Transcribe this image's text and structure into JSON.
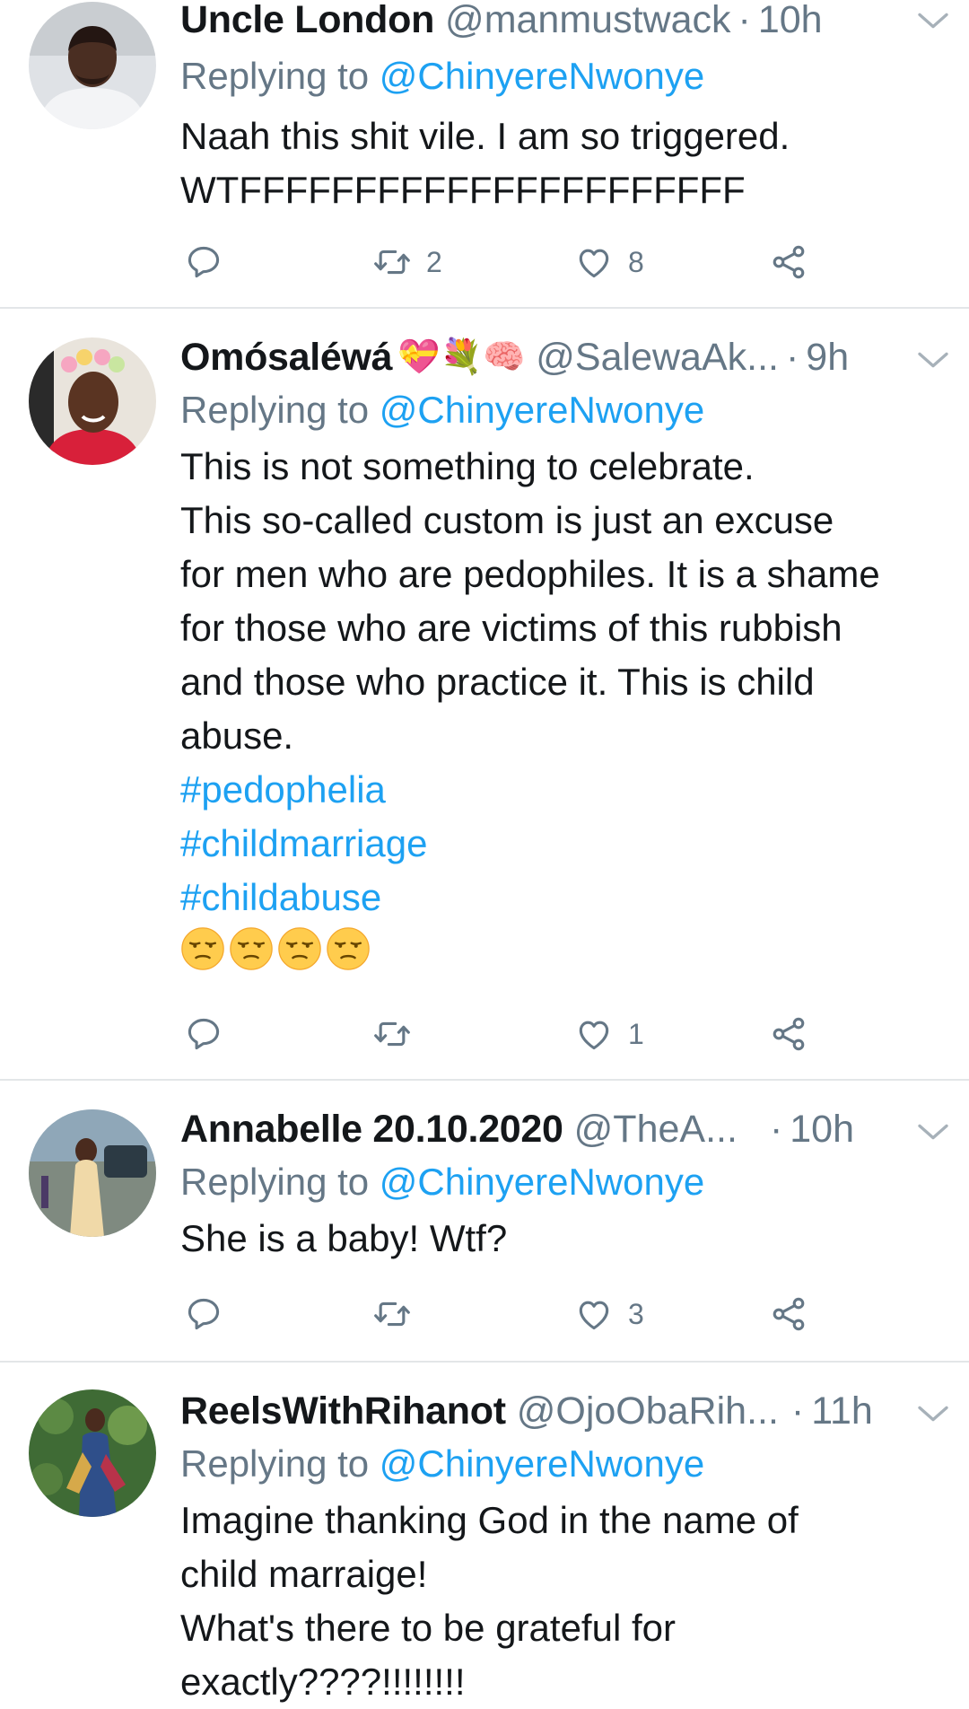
{
  "tweets": [
    {
      "name": "Uncle London",
      "handle": "@manmustwack",
      "dot": "·",
      "time": "10h",
      "reply_prefix": "Replying to ",
      "reply_to": "@ChinyereNwonye",
      "text": "Naah this shit vile. I am so triggered.\nWTFFFFFFFFFFFFFFFFFFFFFF",
      "retweets": "2",
      "likes": "8"
    },
    {
      "name": "Omósaléwá",
      "name_emojis": "💝💐🧠",
      "handle": "@SalewaAk...",
      "dot": "·",
      "time": "9h",
      "reply_prefix": "Replying to ",
      "reply_to": "@ChinyereNwonye",
      "text": "This is not something to celebrate.\nThis so-called custom is just an excuse\nfor men who are pedophiles. It is a shame\nfor those who are victims of this rubbish\nand those who practice it. This is child\nabuse.",
      "hashtags": [
        "#pedophelia",
        "#childmarriage",
        "#childabuse"
      ],
      "emoji_line": "😒😒😒😒",
      "retweets": "",
      "likes": "1"
    },
    {
      "name": "Annabelle 20.10.2020",
      "handle": "@TheA...",
      "dot": "·",
      "time": "10h",
      "reply_prefix": "Replying to ",
      "reply_to": "@ChinyereNwonye",
      "text": "She is a baby! Wtf?",
      "retweets": "",
      "likes": "3"
    },
    {
      "name": "ReelsWithRihanot",
      "handle": "@OjoObaRih...",
      "dot": "·",
      "time": "11h",
      "reply_prefix": "Replying to ",
      "reply_to": "@ChinyereNwonye",
      "text": "Imagine thanking God in the name of\nchild marraige!\nWhat's there to be grateful for\nexactly????!!!!!!!!"
    }
  ],
  "icons": {
    "reply": "reply-icon",
    "retweet": "retweet-icon",
    "like": "heart-icon",
    "share": "share-icon",
    "more": "chevron-down-icon"
  },
  "colors": {
    "link": "#1da1f2",
    "secondary": "#657786",
    "text": "#14171a",
    "divider": "#e3e6e8"
  }
}
